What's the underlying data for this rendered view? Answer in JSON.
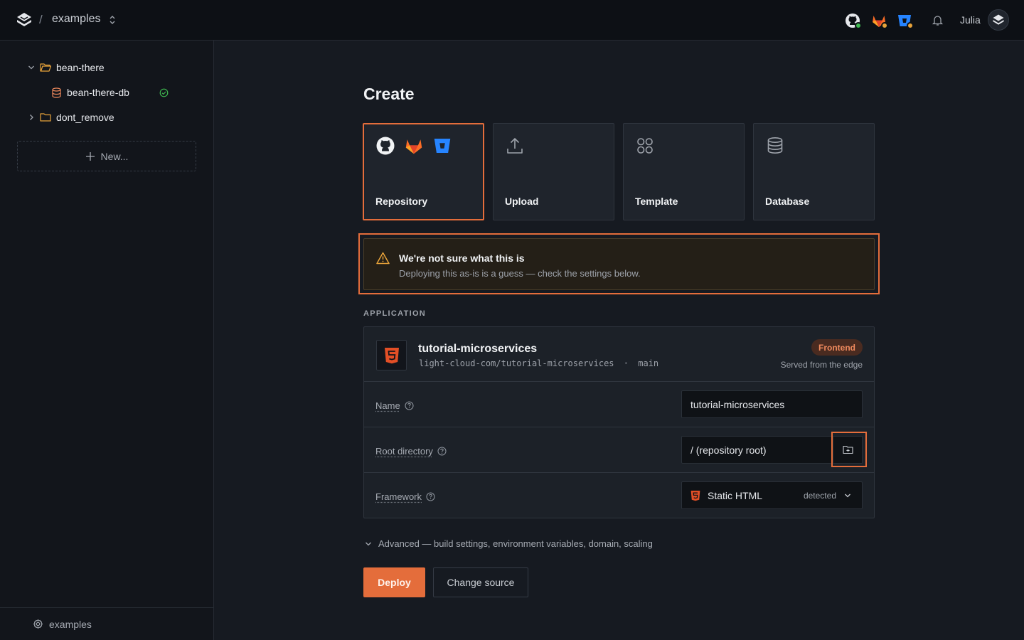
{
  "topbar": {
    "breadcrumb_separator": "/",
    "project": "examples",
    "user_name": "Julia"
  },
  "sidebar": {
    "tree": [
      {
        "label": "bean-there",
        "type": "folder",
        "expanded": true
      },
      {
        "label": "bean-there-db",
        "type": "database",
        "status": "healthy"
      },
      {
        "label": "dont_remove",
        "type": "folder",
        "expanded": false
      }
    ],
    "new_label": "New...",
    "footer_label": "examples"
  },
  "main": {
    "title": "Create",
    "sources": [
      {
        "label": "Repository",
        "selected": true
      },
      {
        "label": "Upload",
        "selected": false
      },
      {
        "label": "Template",
        "selected": false
      },
      {
        "label": "Database",
        "selected": false
      }
    ],
    "warning": {
      "title": "We're not sure what this is",
      "text": "Deploying this as-is is a guess — check the settings below."
    },
    "section_label": "APPLICATION",
    "app": {
      "name": "tutorial-microservices",
      "repo": "light-cloud-com/tutorial-microservices",
      "separator": "·",
      "branch": "main",
      "badge": "Frontend",
      "served": "Served from the edge"
    },
    "form": {
      "name_label": "Name",
      "name_value": "tutorial-microservices",
      "root_label": "Root directory",
      "root_value": "/ (repository root)",
      "framework_label": "Framework",
      "framework_value": "Static HTML",
      "framework_detected": "detected"
    },
    "advanced_label": "Advanced — build settings, environment variables, domain, scaling",
    "deploy_label": "Deploy",
    "change_source_label": "Change source"
  },
  "colors": {
    "accent": "#e46d3b",
    "success": "#3fb950",
    "warning": "#e8a33a",
    "bitbucket": "#2684ff",
    "gitlab": "#fc6d26",
    "html5": "#e34f26"
  }
}
